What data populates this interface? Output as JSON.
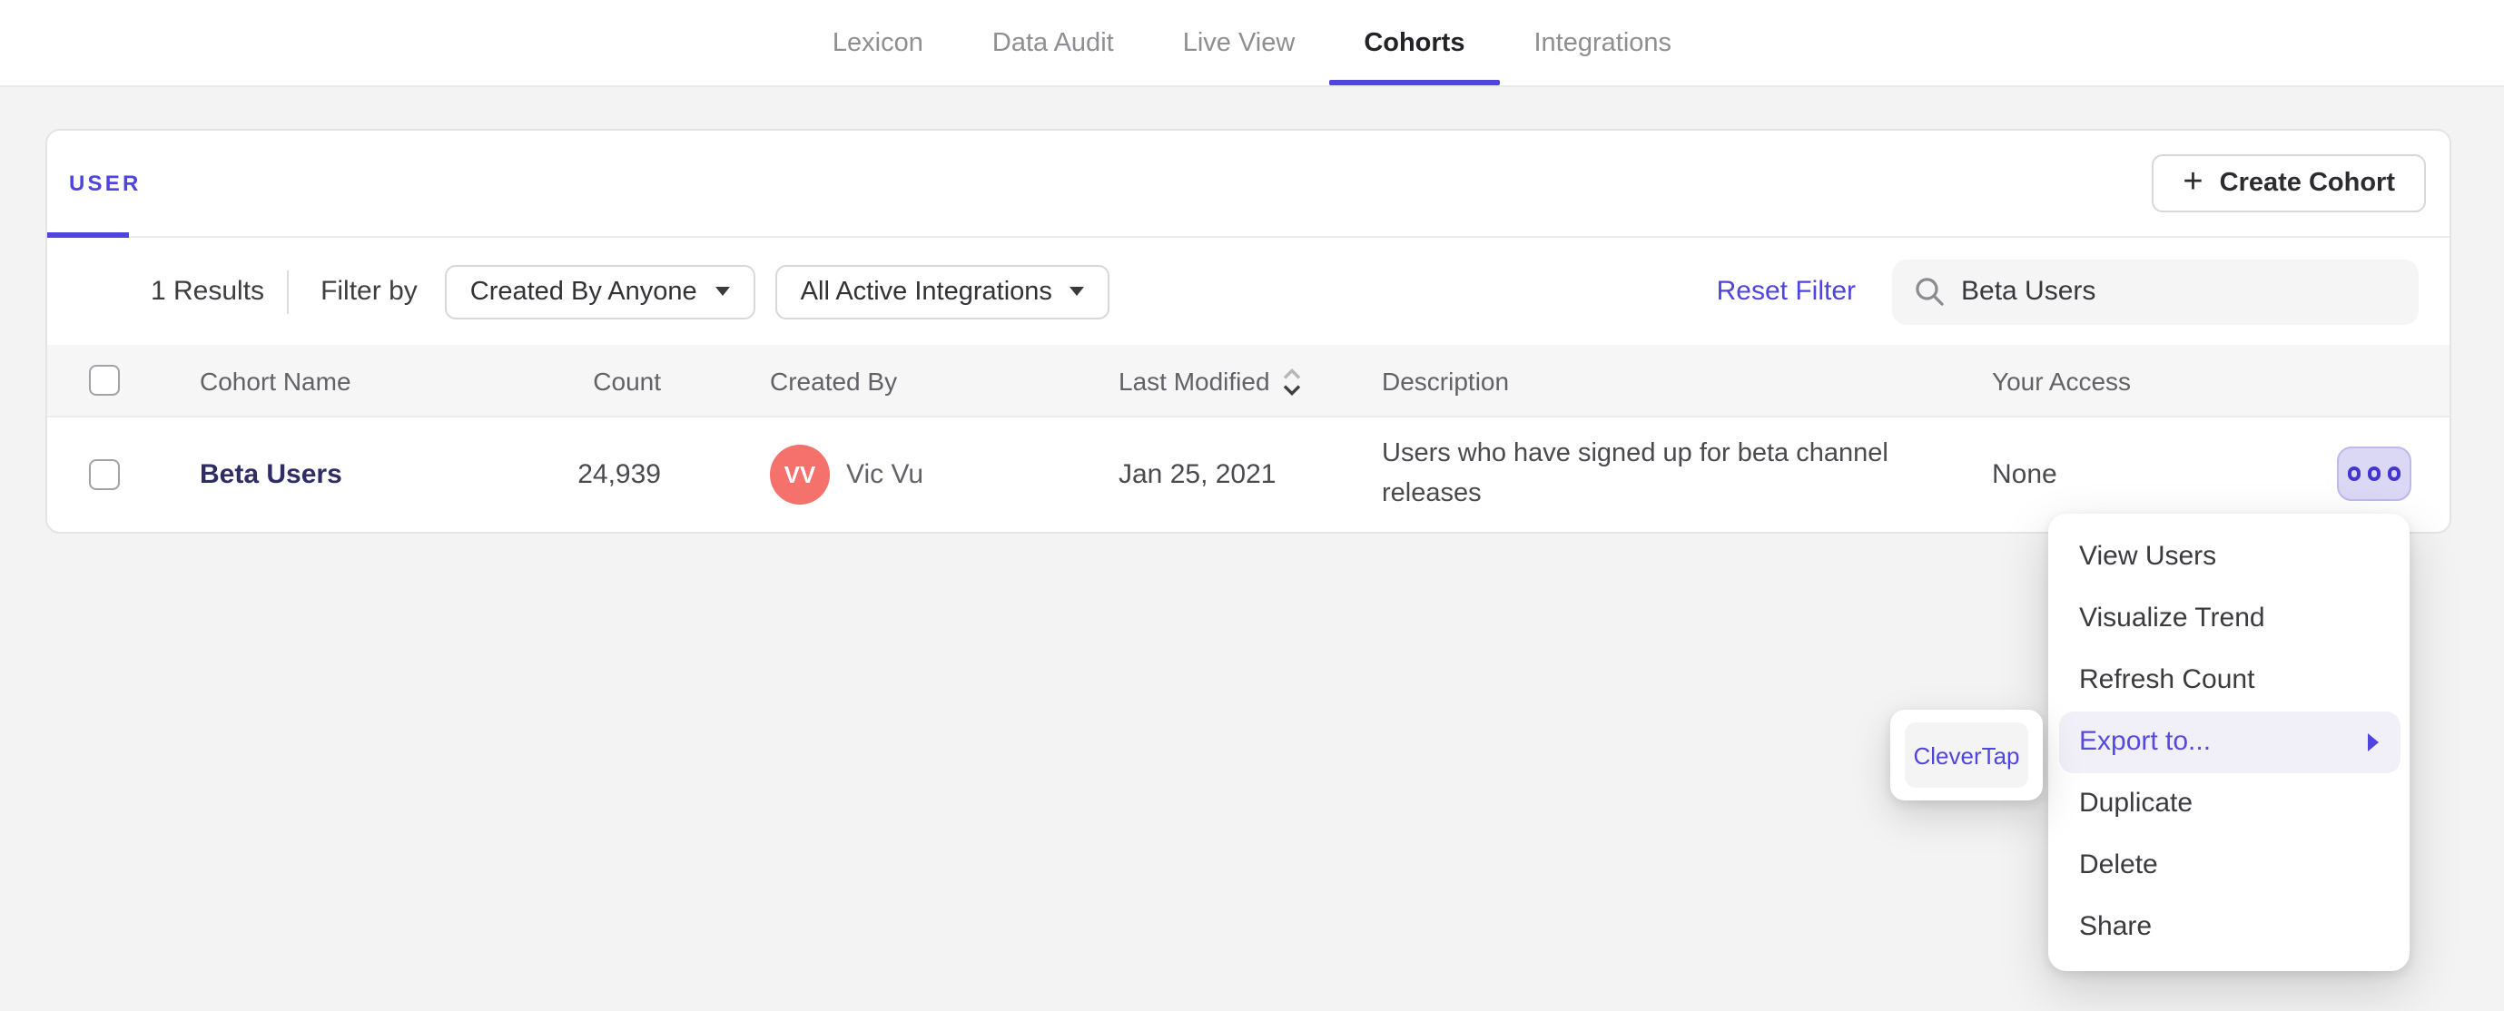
{
  "nav": {
    "items": [
      {
        "label": "Lexicon",
        "active": false
      },
      {
        "label": "Data Audit",
        "active": false
      },
      {
        "label": "Live View",
        "active": false
      },
      {
        "label": "Cohorts",
        "active": true
      },
      {
        "label": "Integrations",
        "active": false
      }
    ]
  },
  "panel": {
    "tab_label": "USER",
    "create_button_label": "Create Cohort",
    "create_button_plus": "+",
    "filters": {
      "results": "1 Results",
      "filter_by": "Filter by",
      "created_by_dropdown": "Created By Anyone",
      "integrations_dropdown": "All Active Integrations",
      "reset": "Reset Filter",
      "search_value": "Beta Users"
    },
    "table": {
      "columns": [
        "Cohort Name",
        "Count",
        "Created By",
        "Last Modified",
        "Description",
        "Your Access"
      ],
      "sort": {
        "column": "Last Modified",
        "direction": "desc"
      },
      "row": {
        "name": "Beta Users",
        "count": "24,939",
        "initials": "VV",
        "created_by": "Vic Vu",
        "last_modified": "Jan 25, 2021",
        "description": "Users who have signed up for beta channel releases",
        "access": "None"
      }
    }
  },
  "context_menu": {
    "items": [
      "View Users",
      "Visualize Trend",
      "Refresh Count",
      "Export to...",
      "Duplicate",
      "Delete",
      "Share"
    ],
    "highlighted_item": "Export to...",
    "submenu": {
      "items": [
        "CleverTap"
      ]
    }
  },
  "icons": {
    "search": "magnifier-icon",
    "sort": "up-down-chevrons-icon",
    "row_menu": "three-dots-icon",
    "dropdown": "caret-down-icon",
    "submenu": "triangle-right-icon"
  },
  "colors": {
    "accent": "#4f44e0",
    "cohort_link": "#2f2c66",
    "avatar": "#f4716c",
    "menu_highlight_bg": "#f1f0f8",
    "page_bg": "#f3f3f4"
  }
}
